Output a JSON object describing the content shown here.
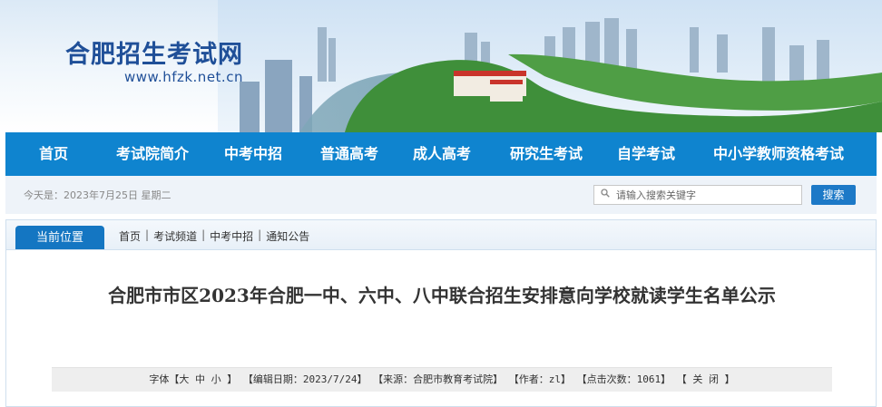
{
  "header": {
    "site_title": "合肥招生考试网",
    "site_url": "www.hfzk.net.cn"
  },
  "nav": {
    "items": [
      "首页",
      "考试院简介",
      "中考中招",
      "普通高考",
      "成人高考",
      "研究生考试",
      "自学考试",
      "中小学教师资格考试"
    ]
  },
  "infobar": {
    "date": "今天是：2023年7月25日  星期二",
    "search_placeholder": "请输入搜索关键字",
    "search_button": "搜索"
  },
  "breadcrumb": {
    "current_label": "当前位置",
    "items": [
      "首页",
      "考试频道",
      "中考中招",
      "通知公告"
    ],
    "separator": "|"
  },
  "article": {
    "title": "合肥市市区2023年合肥一中、六中、八中联合招生安排意向学校就读学生名单公示",
    "meta": {
      "font_label": "字体【",
      "font_large": "大",
      "font_medium": "中",
      "font_small": "小",
      "font_close": "】",
      "edit_date": "【编辑日期：2023/7/24】",
      "source": "【来源：合肥市教育考试院】",
      "author": "【作者：zl】",
      "clicks": "【点击次数：1061】",
      "close": "【 关 闭 】"
    }
  },
  "colors": {
    "nav_bg": "#0f84cf",
    "title_blue": "#1f4f98",
    "search_button": "#1d79c7"
  }
}
